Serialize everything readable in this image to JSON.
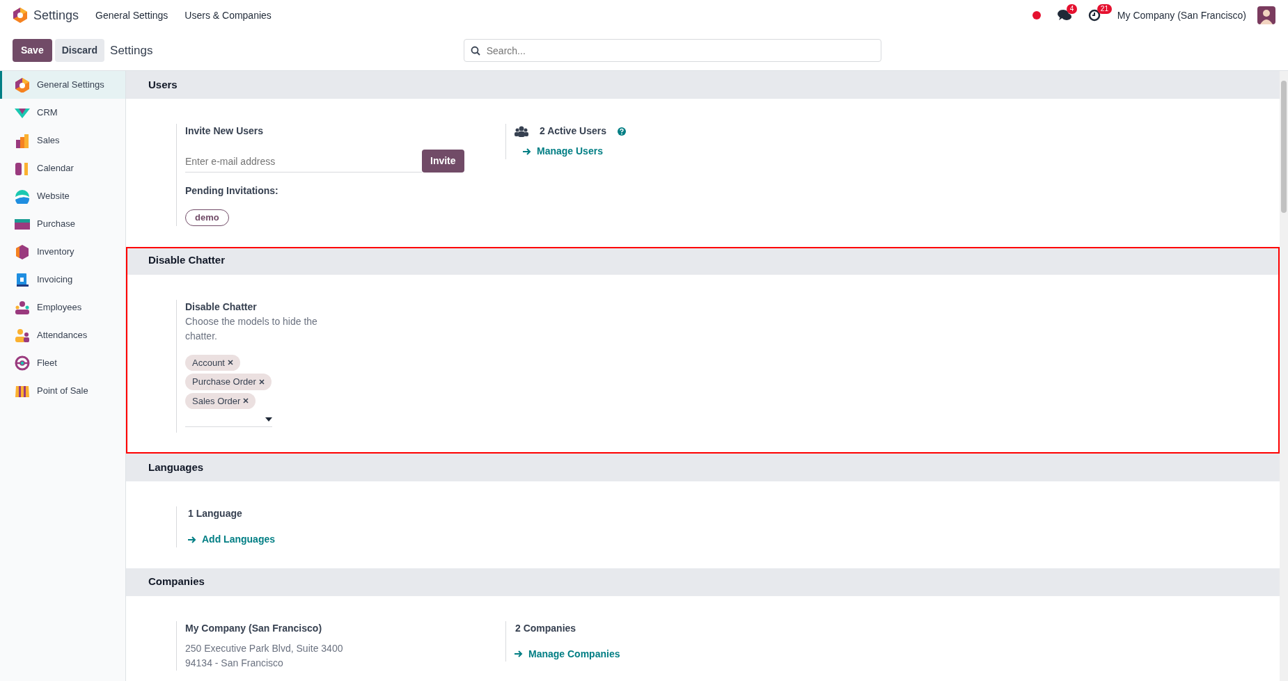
{
  "app": {
    "title": "Settings"
  },
  "menu": [
    {
      "label": "General Settings"
    },
    {
      "label": "Users & Companies"
    }
  ],
  "systray": {
    "messages_count": "4",
    "activities_count": "21",
    "company": "My Company (San Francisco)"
  },
  "control": {
    "save": "Save",
    "discard": "Discard",
    "breadcrumb": "Settings",
    "search_placeholder": "Search..."
  },
  "sidebar": {
    "items": [
      {
        "label": "General Settings",
        "selected": true
      },
      {
        "label": "CRM",
        "selected": false
      },
      {
        "label": "Sales",
        "selected": false
      },
      {
        "label": "Calendar",
        "selected": false
      },
      {
        "label": "Website",
        "selected": false
      },
      {
        "label": "Purchase",
        "selected": false
      },
      {
        "label": "Inventory",
        "selected": false
      },
      {
        "label": "Invoicing",
        "selected": false
      },
      {
        "label": "Employees",
        "selected": false
      },
      {
        "label": "Attendances",
        "selected": false
      },
      {
        "label": "Fleet",
        "selected": false
      },
      {
        "label": "Point of Sale",
        "selected": false
      }
    ]
  },
  "sections": [
    {
      "kind": "users",
      "title": "Users",
      "highlighted": false,
      "invite_label": "Invite New Users",
      "email_placeholder": "Enter e-mail address",
      "invite_button": "Invite",
      "pending_label": "Pending Invitations:",
      "pending": [
        "demo"
      ],
      "active_users": "2 Active Users",
      "manage_link": "Manage Users"
    },
    {
      "kind": "chatter",
      "title": "Disable Chatter",
      "highlighted": true,
      "label": "Disable Chatter",
      "description": "Choose the models to hide the chatter.",
      "tags": [
        "Account",
        "Purchase Order",
        "Sales Order"
      ]
    },
    {
      "kind": "languages",
      "title": "Languages",
      "highlighted": false,
      "count": "1 Language",
      "link": "Add Languages"
    },
    {
      "kind": "companies",
      "title": "Companies",
      "highlighted": false,
      "company_name": "My Company (San Francisco)",
      "address_lines": [
        "250 Executive Park Blvd, Suite 3400",
        "94134 - San Francisco"
      ],
      "count": "2 Companies",
      "link": "Manage Companies"
    }
  ]
}
